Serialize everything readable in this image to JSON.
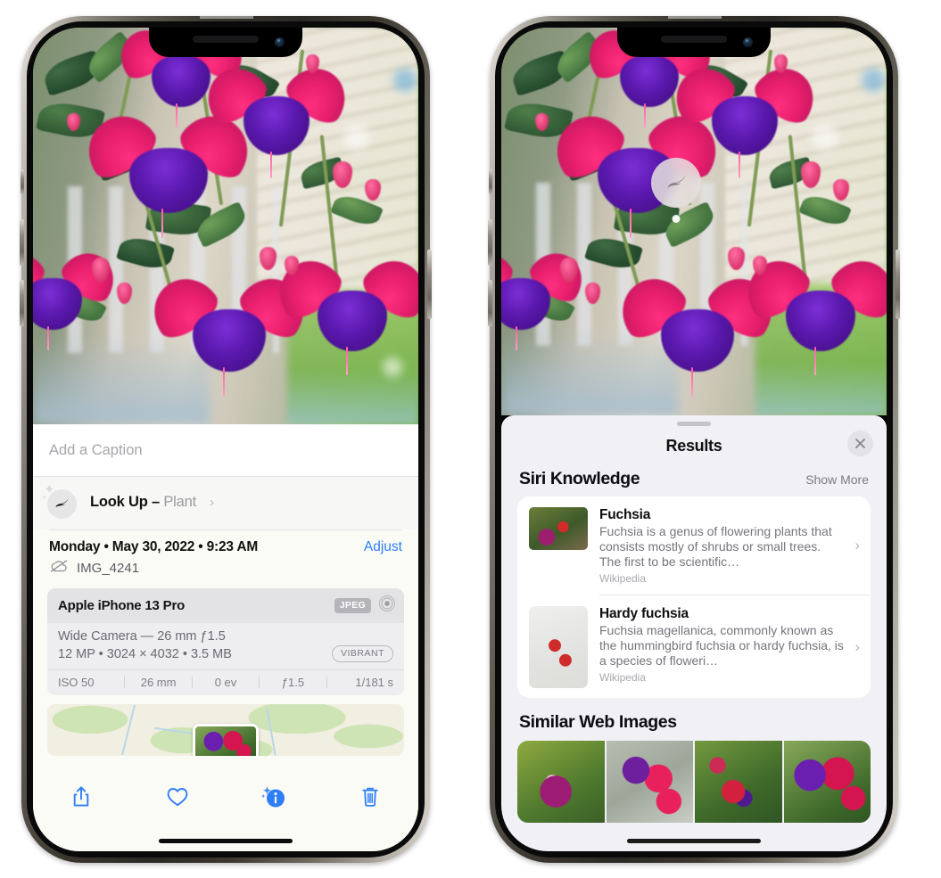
{
  "left_phone": {
    "caption_field": {
      "placeholder": "Add a Caption",
      "value": ""
    },
    "look_up": {
      "label": "Look Up – ",
      "subject": "Plant",
      "chevron": "›",
      "icon": "leaf-icon"
    },
    "date_row": {
      "date": "Monday • May 30, 2022 • 9:23 AM",
      "adjust_label": "Adjust"
    },
    "file_row": {
      "filename": "IMG_4241",
      "icon": "cloud-slash-icon"
    },
    "camera_card": {
      "device": "Apple iPhone 13 Pro",
      "format_badge": "JPEG",
      "raw_icon": "concentric-circle-icon",
      "lens_line": "Wide Camera — 26 mm ƒ1.5",
      "specs_line": "12 MP • 3024 × 4032 • 3.5 MB",
      "style_badge": "VIBRANT",
      "exif": [
        "ISO 50",
        "26 mm",
        "0 ev",
        "ƒ1.5",
        "1/181 s"
      ]
    },
    "toolbar": [
      {
        "name": "share-button",
        "icon": "share-icon"
      },
      {
        "name": "favorite-button",
        "icon": "heart-icon"
      },
      {
        "name": "info-button",
        "icon": "info-sparkle-icon"
      },
      {
        "name": "delete-button",
        "icon": "trash-icon"
      }
    ]
  },
  "right_phone": {
    "badge": {
      "icon": "leaf-icon"
    },
    "sheet": {
      "title": "Results",
      "close_label": "×",
      "siri_knowledge": {
        "section_title": "Siri Knowledge",
        "action": "Show More",
        "items": [
          {
            "title": "Fuchsia",
            "description": "Fuchsia is a genus of flowering plants that consists mostly of shrubs or small trees. The first to be scientific…",
            "source": "Wikipedia",
            "chevron": "›"
          },
          {
            "title": "Hardy fuchsia",
            "description": "Fuchsia magellanica, commonly known as the hummingbird fuchsia or hardy fuchsia, is a species of floweri…",
            "source": "Wikipedia",
            "chevron": "›"
          }
        ]
      },
      "similar_web_images": {
        "section_title": "Similar Web Images",
        "count": 4
      }
    }
  },
  "colors": {
    "accent_blue": "#2e7ef7",
    "sheet_bg": "#f1f0f5",
    "card_bg": "#ffffff",
    "info_bg": "#fbfbf6",
    "secondary_text": "#75757c"
  }
}
